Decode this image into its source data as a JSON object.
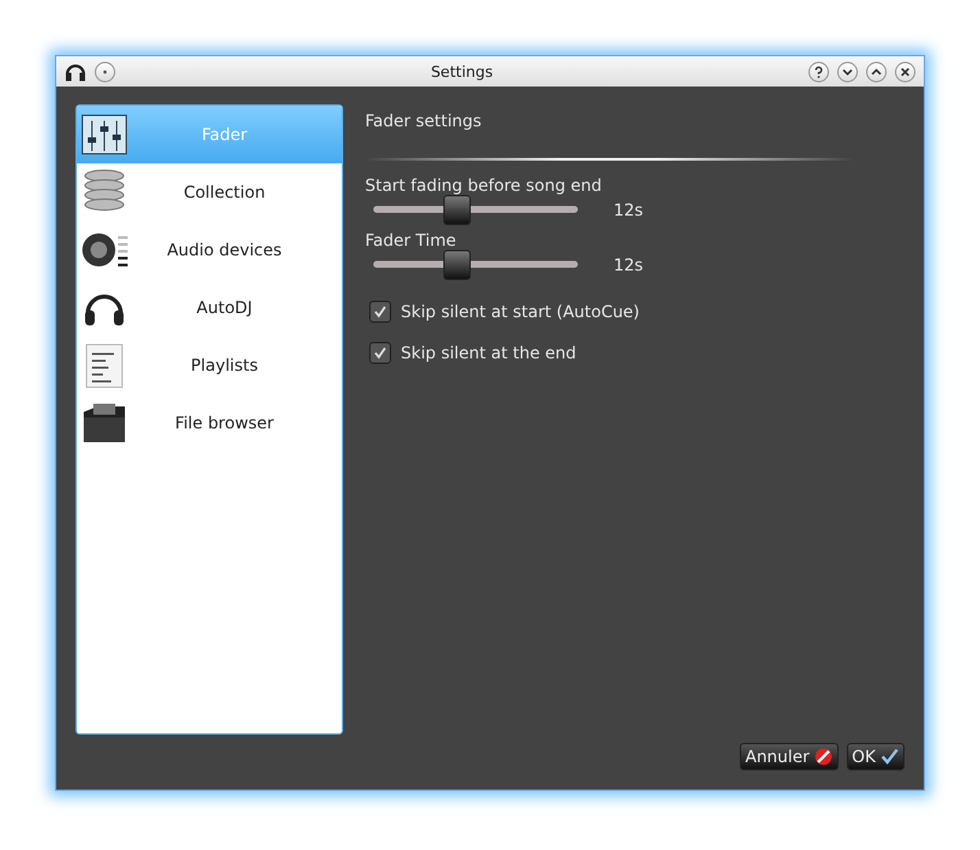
{
  "window": {
    "title": "Settings"
  },
  "sidebar": {
    "items": [
      {
        "label": "Fader",
        "kind": "fader",
        "selected": true
      },
      {
        "label": "Collection",
        "kind": "collection",
        "selected": false
      },
      {
        "label": "Audio devices",
        "kind": "audio",
        "selected": false
      },
      {
        "label": "AutoDJ",
        "kind": "headphones",
        "selected": false
      },
      {
        "label": "Playlists",
        "kind": "playlist",
        "selected": false
      },
      {
        "label": "File browser",
        "kind": "folder",
        "selected": false
      }
    ]
  },
  "section_title": "Fader settings",
  "sliders": [
    {
      "label": "Start fading before song end",
      "level": 0.41,
      "reading": "12s"
    },
    {
      "label": "Fader Time",
      "level": 0.41,
      "reading": "12s"
    }
  ],
  "checkboxes": [
    {
      "label": "Skip silent at start (AutoCue)",
      "checked": true
    },
    {
      "label": "Skip silent at the end",
      "checked": true
    }
  ],
  "buttons": [
    {
      "label": "Annuler",
      "kind": "cancel"
    },
    {
      "label": "OK",
      "kind": "ok"
    }
  ]
}
